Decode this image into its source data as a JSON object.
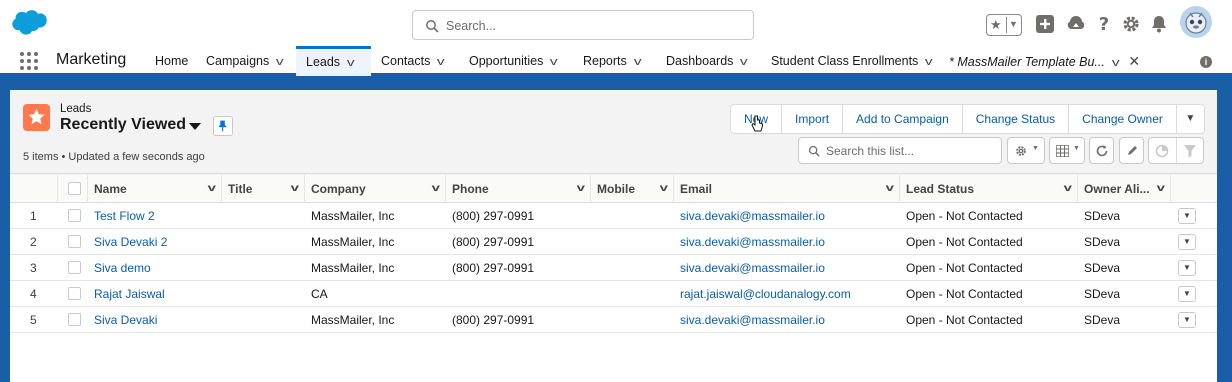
{
  "header": {
    "search_placeholder": "Search...",
    "icons": [
      "salesforce-logo",
      "favorites-star-icon",
      "add-icon",
      "trailhead-icon",
      "help-icon",
      "setup-gear-icon",
      "notifications-bell-icon",
      "avatar"
    ]
  },
  "nav": {
    "app_name": "Marketing",
    "items": [
      {
        "label": "Home",
        "has_menu": false
      },
      {
        "label": "Campaigns",
        "has_menu": true
      },
      {
        "label": "Leads",
        "has_menu": true,
        "active": true
      },
      {
        "label": "Contacts",
        "has_menu": true
      },
      {
        "label": "Opportunities",
        "has_menu": true
      },
      {
        "label": "Reports",
        "has_menu": true
      },
      {
        "label": "Dashboards",
        "has_menu": true
      },
      {
        "label": "Student Class Enrollments",
        "has_menu": true
      },
      {
        "label": "* MassMailer Template Bu...",
        "has_menu": true,
        "closable": true
      }
    ]
  },
  "list_view": {
    "object_label": "Leads",
    "title": "Recently Viewed",
    "status": "5 items • Updated a few seconds ago",
    "actions": [
      "New",
      "Import",
      "Add to Campaign",
      "Change Status",
      "Change Owner"
    ],
    "search_placeholder": "Search this list..."
  },
  "table": {
    "columns": [
      "Name",
      "Title",
      "Company",
      "Phone",
      "Mobile",
      "Email",
      "Lead Status",
      "Owner Ali..."
    ],
    "rows": [
      {
        "num": "1",
        "name": "Test Flow 2",
        "title": "",
        "company": "MassMailer, Inc",
        "phone": "(800) 297-0991",
        "mobile": "",
        "email": "siva.devaki@massmailer.io",
        "status": "Open - Not Contacted",
        "owner": "SDeva"
      },
      {
        "num": "2",
        "name": "Siva Devaki 2",
        "title": "",
        "company": "MassMailer, Inc",
        "phone": "(800) 297-0991",
        "mobile": "",
        "email": "siva.devaki@massmailer.io",
        "status": "Open - Not Contacted",
        "owner": "SDeva"
      },
      {
        "num": "3",
        "name": "Siva demo",
        "title": "",
        "company": "MassMailer, Inc",
        "phone": "(800) 297-0991",
        "mobile": "",
        "email": "siva.devaki@massmailer.io",
        "status": "Open - Not Contacted",
        "owner": "SDeva"
      },
      {
        "num": "4",
        "name": "Rajat Jaiswal",
        "title": "",
        "company": "CA",
        "phone": "",
        "mobile": "",
        "email": "rajat.jaiswal@cloudanalogy.com",
        "status": "Open - Not Contacted",
        "owner": "SDeva"
      },
      {
        "num": "5",
        "name": "Siva Devaki",
        "title": "",
        "company": "MassMailer, Inc",
        "phone": "(800) 297-0991",
        "mobile": "",
        "email": "siva.devaki@massmailer.io",
        "status": "Open - Not Contacted",
        "owner": "SDeva"
      }
    ]
  },
  "colors": {
    "brand": "#0176d3",
    "link": "#0b5cab",
    "lead_icon": "#ff784f",
    "background": "#1b5ea8"
  }
}
